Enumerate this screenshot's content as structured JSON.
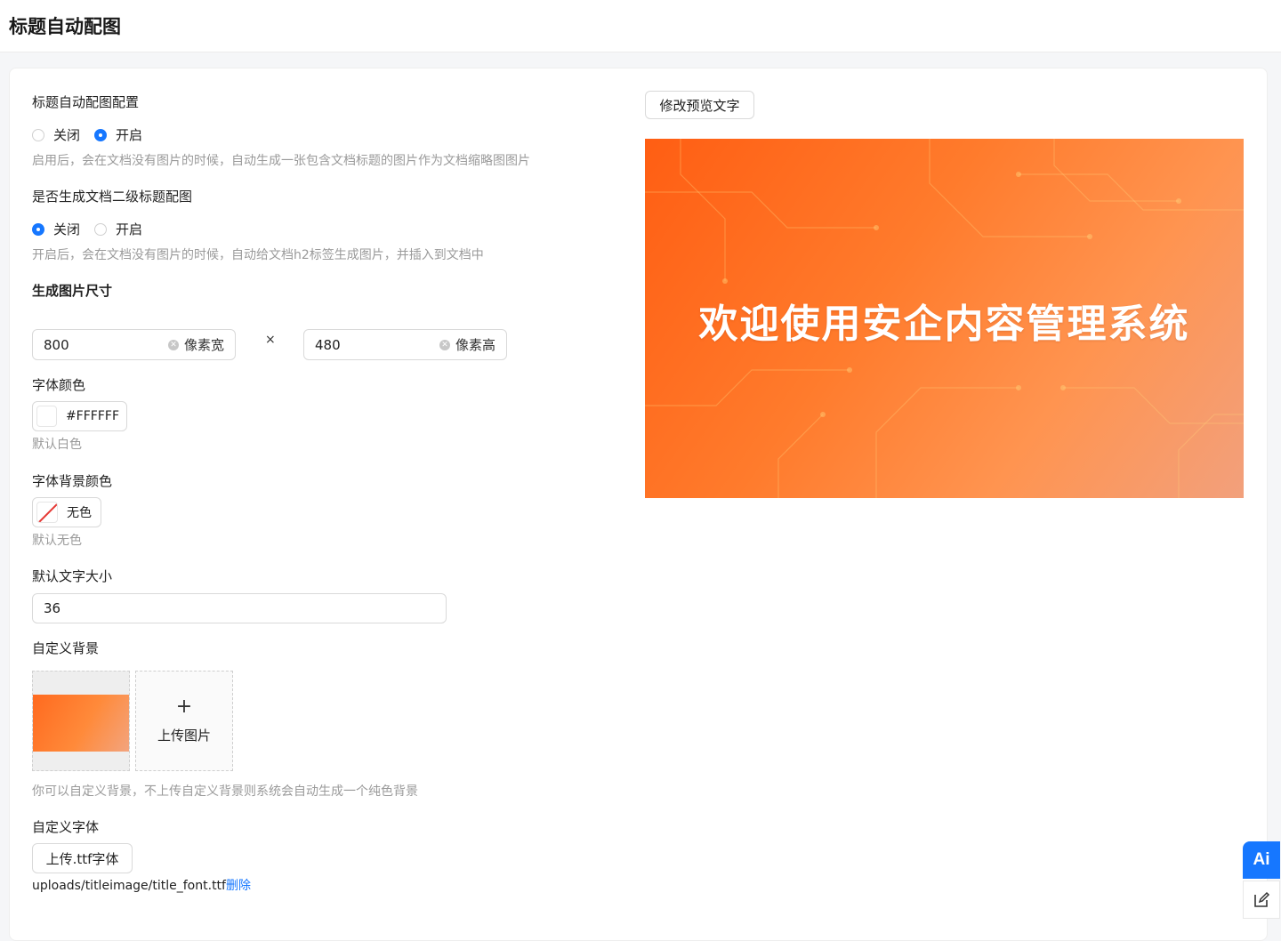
{
  "header": {
    "title": "标题自动配图"
  },
  "config": {
    "auto_image": {
      "label": "标题自动配图配置",
      "options": [
        "关闭",
        "开启"
      ],
      "selected": "开启",
      "hint": "启用后，会在文档没有图片的时候，自动生成一张包含文档标题的图片作为文档缩略图图片"
    },
    "h2_image": {
      "label": "是否生成文档二级标题配图",
      "options": [
        "关闭",
        "开启"
      ],
      "selected": "关闭",
      "hint": "开启后，会在文档没有图片的时候，自动给文档h2标签生成图片，并插入到文档中"
    },
    "size": {
      "label": "生成图片尺寸",
      "width_value": "800",
      "width_suffix": "像素宽",
      "separator": "×",
      "height_value": "480",
      "height_suffix": "像素高"
    },
    "font_color": {
      "label": "字体颜色",
      "value": "#FFFFFF",
      "hint": "默认白色"
    },
    "bg_color": {
      "label": "字体背景颜色",
      "value": "无色",
      "hint": "默认无色"
    },
    "font_size": {
      "label": "默认文字大小",
      "value": "36"
    },
    "custom_bg": {
      "label": "自定义背景",
      "upload_label": "上传图片",
      "hint": "你可以自定义背景，不上传自定义背景则系统会自动生成一个纯色背景"
    },
    "custom_font": {
      "label": "自定义字体",
      "button_label": "上传.ttf字体",
      "file_path": "uploads/titleimage/title_font.ttf",
      "delete_label": "删除"
    }
  },
  "preview": {
    "edit_button_label": "修改预览文字",
    "text": "欢迎使用安企内容管理系统",
    "text_color": "#FFFFFF",
    "accent_color": "#FF6A1F"
  },
  "floating": {
    "ai_label": "Ai"
  },
  "colors": {
    "primary": "#1677ff",
    "hint": "#9a9a9a"
  }
}
